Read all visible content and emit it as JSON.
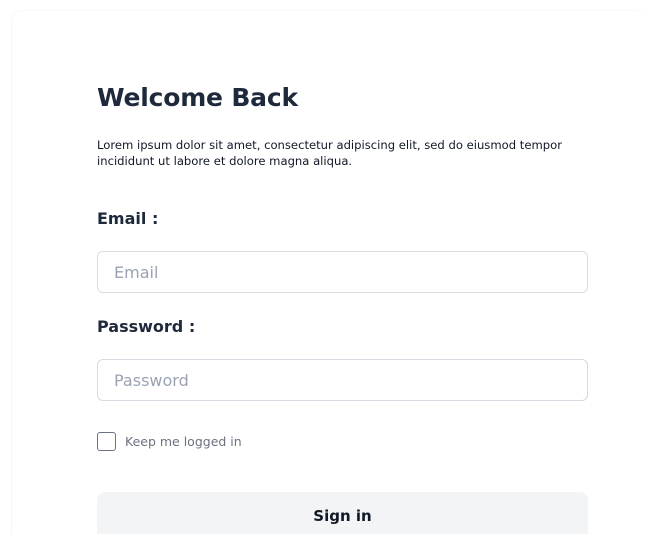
{
  "login": {
    "title": "Welcome Back",
    "description": "Lorem ipsum dolor sit amet, consectetur adipiscing elit, sed do eiusmod tempor incididunt ut labore et dolore magna aliqua.",
    "email": {
      "label": "Email :",
      "placeholder": "Email",
      "value": ""
    },
    "password": {
      "label": "Password :",
      "placeholder": "Password",
      "value": ""
    },
    "remember": {
      "label": "Keep me logged in",
      "checked": false
    },
    "submit_label": "Sign in"
  },
  "colors": {
    "title": "#1e293b",
    "input_border": "#d7dce3",
    "placeholder": "#9aa3b2",
    "button_bg": "#f3f4f6"
  }
}
